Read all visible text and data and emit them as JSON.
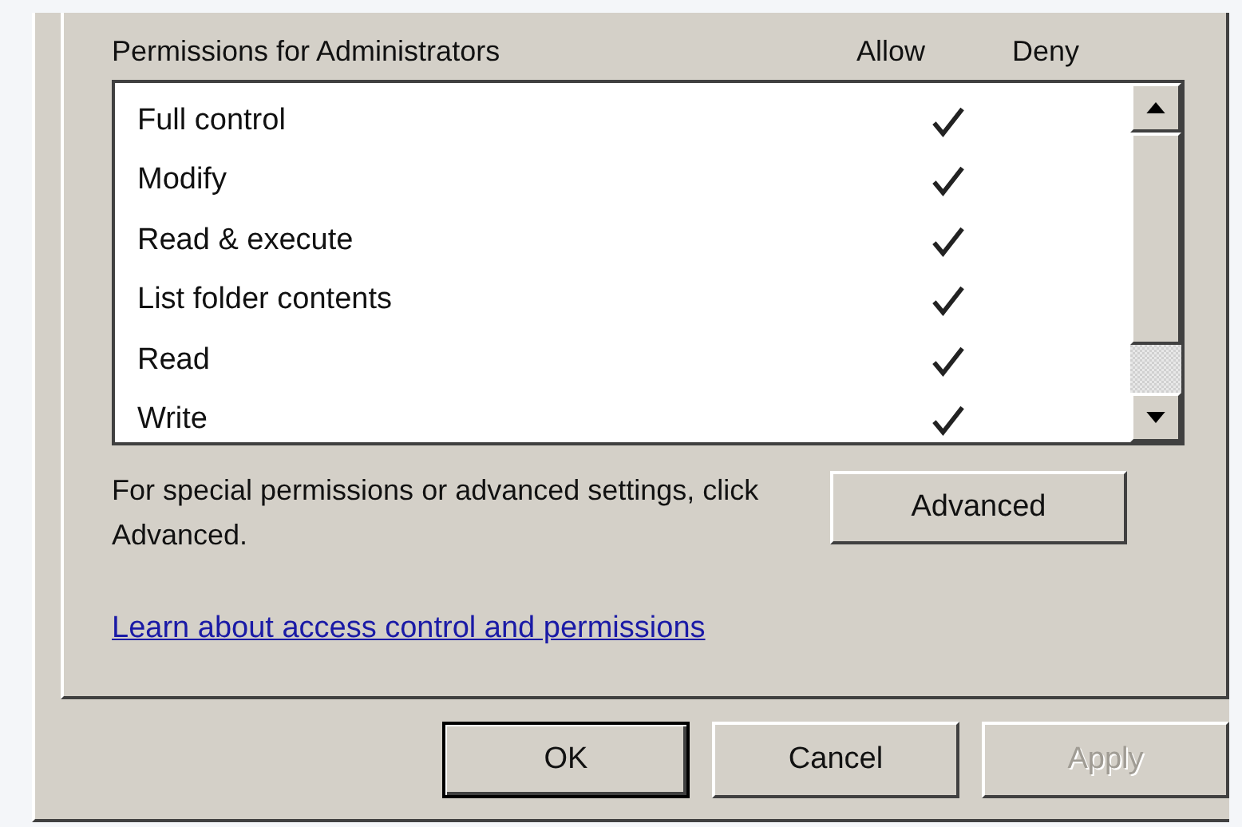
{
  "permissions": {
    "heading": "Permissions for Administrators",
    "columns": [
      "Allow",
      "Deny"
    ],
    "rows": [
      {
        "name": "Full control",
        "allow": true,
        "deny": false
      },
      {
        "name": "Modify",
        "allow": true,
        "deny": false
      },
      {
        "name": "Read & execute",
        "allow": true,
        "deny": false
      },
      {
        "name": "List folder contents",
        "allow": true,
        "deny": false
      },
      {
        "name": "Read",
        "allow": true,
        "deny": false
      },
      {
        "name": "Write",
        "allow": true,
        "deny": false
      }
    ]
  },
  "advanced": {
    "text": "For special permissions or advanced settings, click Advanced.",
    "button": "Advanced"
  },
  "link": "Learn about access control and permissions",
  "buttons": [
    {
      "label": "OK",
      "default": true,
      "disabled": false
    },
    {
      "label": "Cancel",
      "default": false,
      "disabled": false
    },
    {
      "label": "Apply",
      "default": false,
      "disabled": true
    }
  ]
}
